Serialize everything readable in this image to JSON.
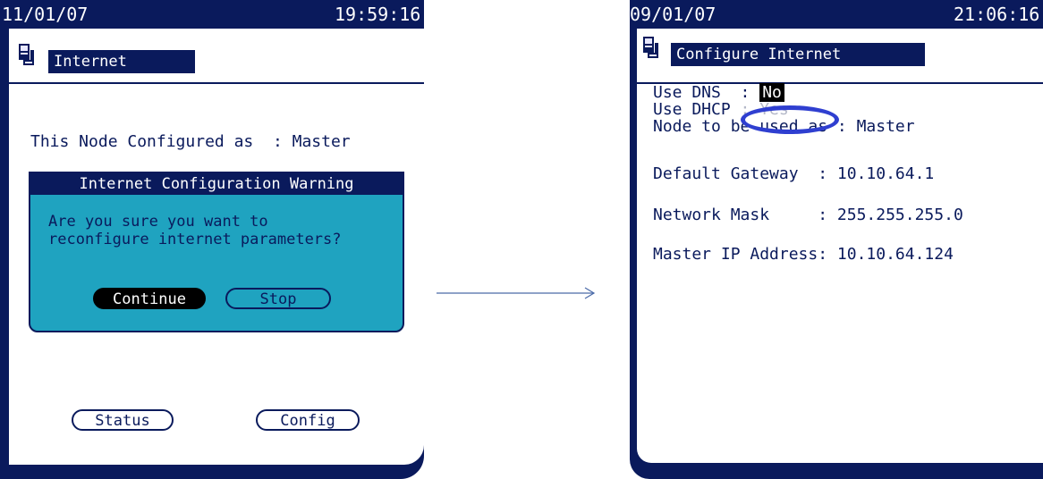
{
  "left_screen": {
    "date": "11/01/07",
    "time": "19:59:16",
    "title": "Internet",
    "node_config_label": "This Node Configured as",
    "node_config_value": ": Master",
    "dialog": {
      "title": "Internet Configuration Warning",
      "message_line1": "Are you sure you want to",
      "message_line2": "reconfigure internet parameters?",
      "continue_label": "Continue",
      "stop_label": "Stop"
    },
    "status_label": "Status",
    "config_label": "Config"
  },
  "right_screen": {
    "date": "09/01/07",
    "time": "21:06:16",
    "title": "Configure Internet",
    "use_dns_label": "Use DNS  :",
    "use_dns_value": "No",
    "use_dhcp_label": "Use DHCP",
    "use_dhcp_value": ": Yes",
    "node_used_as": "Node to be used as : Master",
    "default_gateway": "Default Gateway  : 10.10.64.1",
    "network_mask": "Network Mask     : 255.255.255.0",
    "master_ip": "Master IP Address: 10.10.64.124"
  },
  "colors": {
    "frame": "#0a1a5c",
    "dialog_bg": "#1fa3c0",
    "highlight_circle": "#2f3fd0",
    "arrow": "#4a6aa8"
  }
}
